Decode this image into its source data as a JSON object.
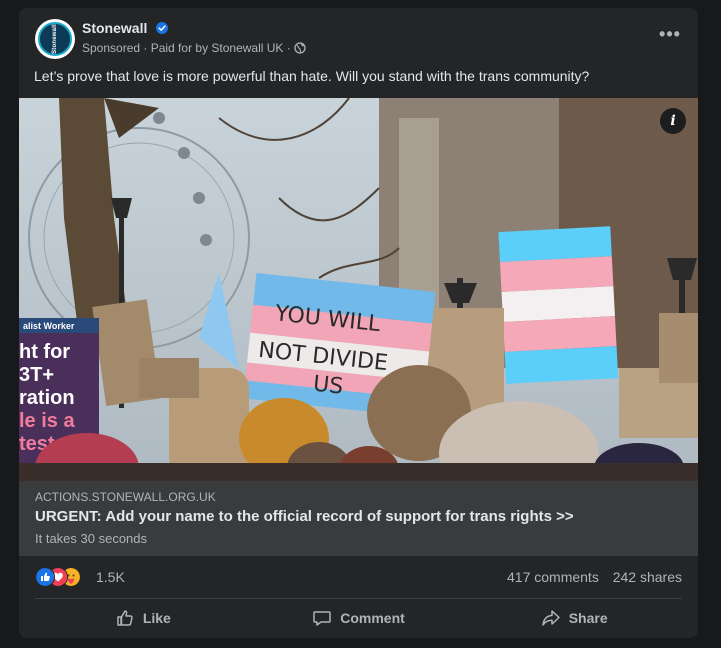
{
  "post": {
    "page_name": "Stonewall",
    "avatar_text": "Stonewall",
    "meta": "Sponsored · Paid for by Stonewall UK ·",
    "text": "Let’s prove that love is more powerful than hate. Will you stand with the trans community?"
  },
  "photo": {
    "sign_text": [
      "YOU WILL",
      "NOT DIVIDE",
      "US"
    ],
    "left_sign_header": "alist Worker",
    "left_sign_lines": [
      "ht for",
      "3T+",
      "ration",
      "le is a",
      "test"
    ],
    "info_label": "i"
  },
  "link": {
    "domain": "ACTIONS.STONEWALL.ORG.UK",
    "title": "URGENT: Add your name to the official record of support for trans rights >>",
    "subtitle": "It takes 30 seconds"
  },
  "engagement": {
    "reaction_count": "1.5K",
    "comments": "417 comments",
    "shares": "242 shares"
  },
  "actions": {
    "like": "Like",
    "comment": "Comment",
    "share": "Share"
  },
  "icons": {
    "more": "more-options-icon",
    "globe": "globe-icon",
    "verified": "verified-badge-icon",
    "info": "info-icon",
    "like": "thumbs-up-icon",
    "comment": "comment-bubble-icon",
    "share": "share-arrow-icon"
  },
  "colors": {
    "card_bg": "#242526",
    "page_bg": "#18191a",
    "link_box_bg": "#3a3b3c",
    "verified_blue": "#1b74e4",
    "trans_blue": "#5bcefa",
    "trans_pink": "#f5a9b8"
  }
}
